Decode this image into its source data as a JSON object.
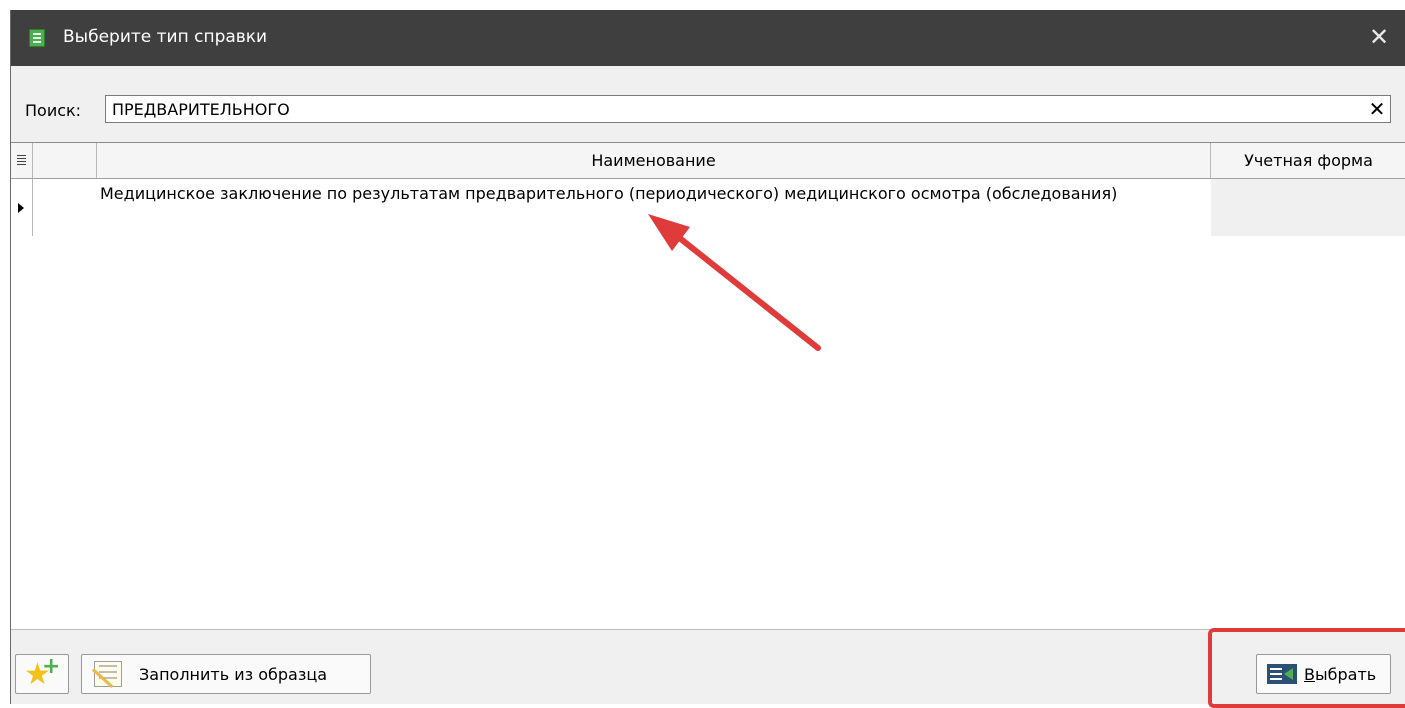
{
  "window": {
    "title": "Выберите тип справки",
    "close_symbol": "✕"
  },
  "search": {
    "label": "Поиск:",
    "value": "ПРЕДВАРИТЕЛЬНОГО",
    "clear_symbol": "✕"
  },
  "grid": {
    "columns": [
      "",
      "",
      "Наименование",
      "Учетная форма"
    ],
    "rows": [
      {
        "name": "Медицинское заключение по результатам предварительного (периодического) медицинского осмотра (обследования)",
        "form": "",
        "selected": true
      }
    ]
  },
  "footer": {
    "new_button_icon": "star-plus-icon",
    "fill_button_label": "Заполнить из образца",
    "select_button_label_first": "В",
    "select_button_label_rest": "ыбрать"
  },
  "annotations": {
    "color": "#e03b3b"
  }
}
